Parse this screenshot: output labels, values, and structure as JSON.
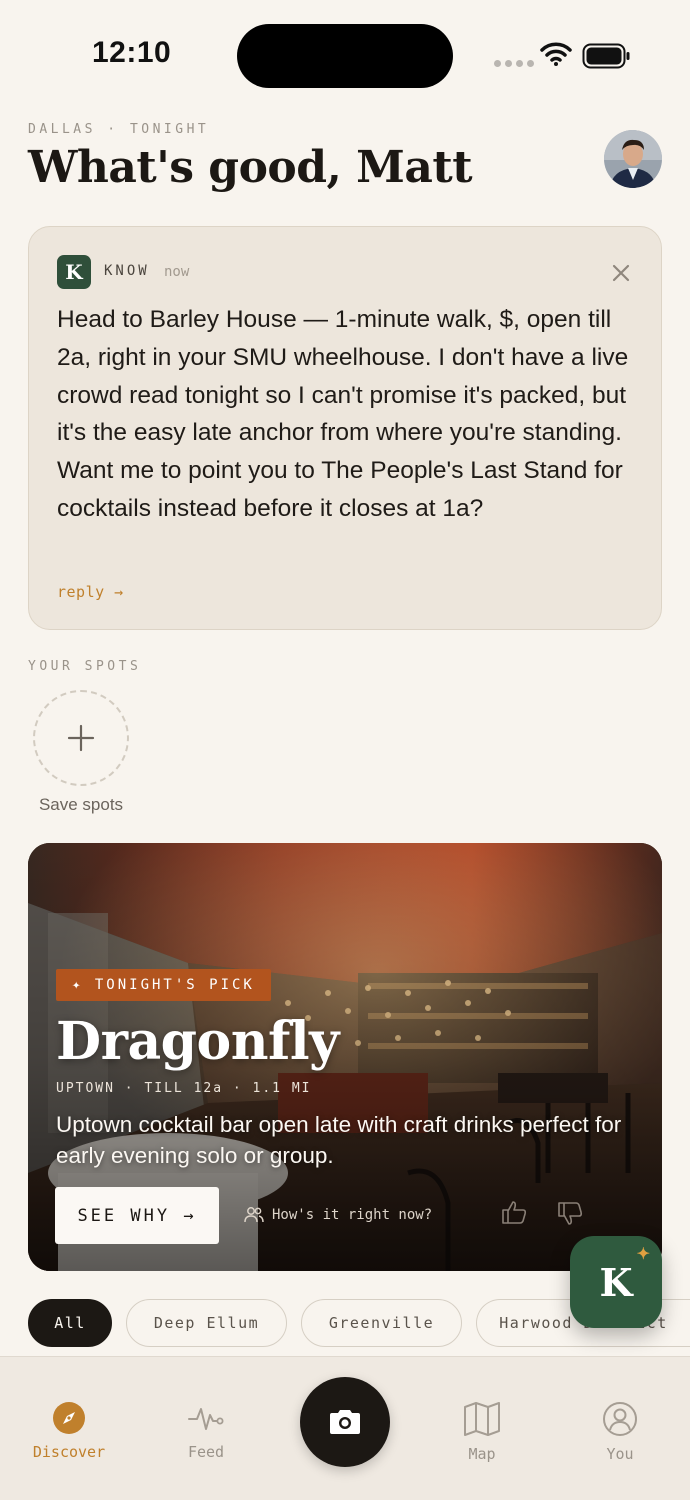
{
  "status_bar": {
    "time": "12:10"
  },
  "header": {
    "eyebrow": "DALLAS · TONIGHT",
    "greeting": "What's good, Matt"
  },
  "know_card": {
    "badge": "K",
    "name": "KNOW",
    "time": "now",
    "message": "Head to Barley House — 1-minute walk, $, open till 2a, right in your SMU wheelhouse. I don't have a live crowd read tonight so I can't promise it's packed, but it's the easy late anchor from where you're standing. Want me to point you to The People's Last Stand for cocktails instead before it closes at 1a?",
    "reply": "reply →"
  },
  "spots": {
    "label": "YOUR SPOTS",
    "add_label": "Save spots"
  },
  "hero": {
    "badge": "✦ TONIGHT'S PICK",
    "title": "Dragonfly",
    "meta": "UPTOWN · TILL 12a · 1.1 MI",
    "description": "Uptown cocktail bar open late with craft drinks perfect for early evening solo or group.",
    "cta": "SEE WHY →",
    "secondary": "How's it right now?"
  },
  "chips": [
    "All",
    "Deep Ellum",
    "Greenville",
    "Harwood District"
  ],
  "fab": {
    "label": "K",
    "spark": "✦"
  },
  "tabs": {
    "discover": "Discover",
    "feed": "Feed",
    "map": "Map",
    "you": "You"
  },
  "colors": {
    "accent": "#c0802c",
    "brand_green": "#2f5a3e",
    "pick_orange": "#b2541e",
    "background": "#f8f4ee"
  }
}
